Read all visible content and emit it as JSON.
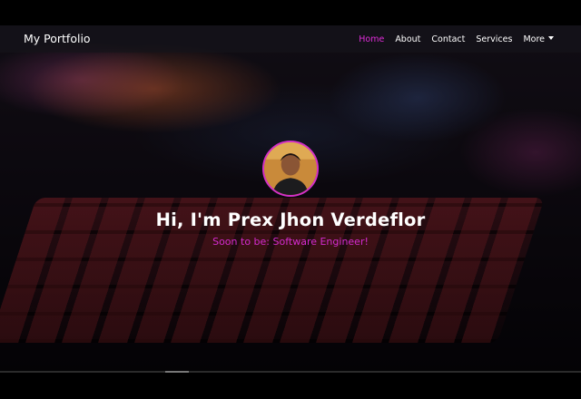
{
  "brand": {
    "label": "My Portfolio"
  },
  "nav": {
    "items": [
      {
        "label": "Home",
        "active": true
      },
      {
        "label": "About"
      },
      {
        "label": "Contact"
      },
      {
        "label": "Services"
      },
      {
        "label": "More"
      }
    ]
  },
  "hero": {
    "title": "Hi, I'm Prex Jhon Verdeflor",
    "subtitle": "Soon to be: Software Engineer!",
    "avatar_icon": "profile-photo"
  },
  "colors": {
    "accent": "#e02dd9",
    "subtitle": "#d42bd0",
    "navbar_bg": "#16141a",
    "text": "#ffffff"
  }
}
